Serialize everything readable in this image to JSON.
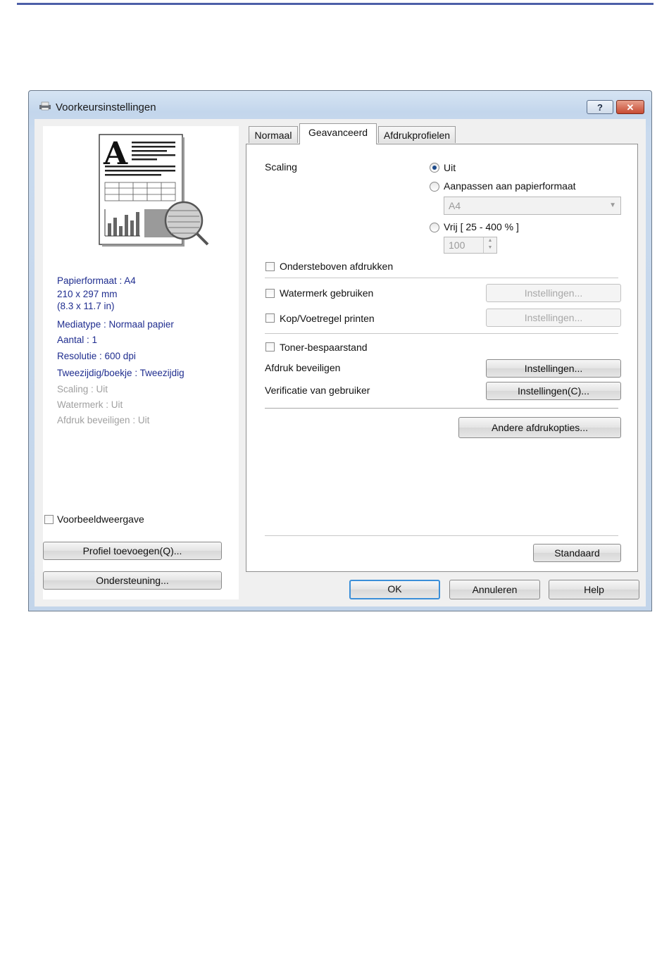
{
  "window": {
    "title": "Voorkeursinstellingen",
    "help_label": "?",
    "close_label": "✕"
  },
  "tabs": [
    {
      "label": "Normaal"
    },
    {
      "label": "Geavanceerd"
    },
    {
      "label": "Afdrukprofielen"
    }
  ],
  "summary": {
    "paper_size": "Papierformaat : A4",
    "dimensions_mm": "210 x 297 mm",
    "dimensions_in": "(8.3 x 11.7 in)",
    "media_type": "Mediatype : Normaal papier",
    "copies": "Aantal : 1",
    "resolution": "Resolutie : 600 dpi",
    "duplex": "Tweezijdig/boekje : Tweezijdig",
    "scaling": "Scaling : Uit",
    "watermark": "Watermerk : Uit",
    "secure_print": "Afdruk beveiligen : Uit"
  },
  "left": {
    "preview_checkbox": "Voorbeeldweergave",
    "add_profile_button": "Profiel toevoegen(Q)...",
    "support_button": "Ondersteuning..."
  },
  "advanced": {
    "scaling_label": "Scaling",
    "scaling_options": {
      "off": "Uit",
      "fit": "Aanpassen aan papierformaat",
      "free": "Vrij [ 25 - 400 % ]"
    },
    "scaling_selected": "Uit",
    "fit_paper_value": "A4",
    "free_value": "100",
    "upside_down": "Ondersteboven afdrukken",
    "watermark": "Watermerk gebruiken",
    "watermark_settings": "Instellingen...",
    "header_footer": "Kop/Voetregel printen",
    "header_footer_settings": "Instellingen...",
    "toner_save": "Toner-bespaarstand",
    "secure_print": "Afdruk beveiligen",
    "secure_print_settings": "Instellingen...",
    "user_verification": "Verificatie van gebruiker",
    "user_verification_settings": "Instellingen(C)...",
    "other_options": "Andere afdrukopties...",
    "default_button": "Standaard"
  },
  "footer": {
    "ok": "OK",
    "cancel": "Annuleren",
    "help": "Help"
  },
  "colors": {
    "info_text": "#1f2d8f",
    "info_disabled": "#a0a0a0",
    "default_button_border": "#3b8fd8"
  }
}
